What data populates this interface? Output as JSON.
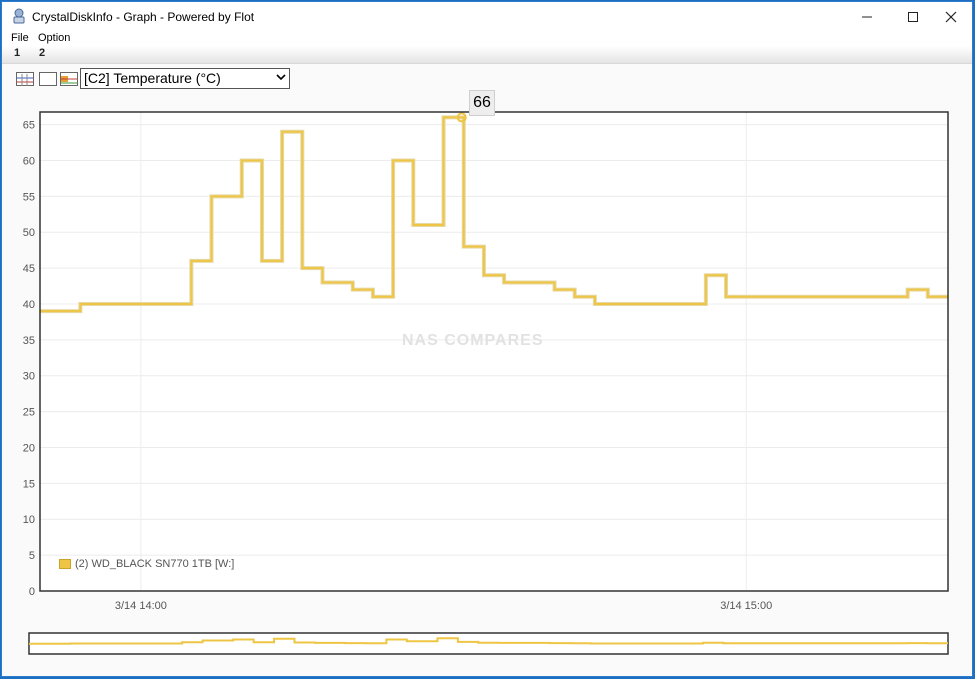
{
  "window": {
    "title": "CrystalDiskInfo - Graph - Powered by Flot",
    "minimize_icon": "minimize-icon",
    "maximize_icon": "maximize-icon",
    "close_icon": "close-icon"
  },
  "menu": {
    "items": [
      "File",
      "Option"
    ]
  },
  "tabs": [
    "1",
    "2"
  ],
  "toolbar": {
    "icons": [
      "graph-multi-icon",
      "graph-blank-icon",
      "graph-settings-icon"
    ],
    "attribute_select": "[C2] Temperature (°C)"
  },
  "tooltip": "66",
  "watermark": "NAS COMPARES",
  "legend": {
    "label": "(2) WD_BLACK SN770 1TB [W:]",
    "color": "#eec545"
  },
  "chart_data": {
    "type": "line",
    "series": [
      {
        "name": "(2) WD_BLACK SN770 1TB [W:]",
        "color": "#eec545",
        "step": true,
        "x": [
          "13:50",
          "13:54",
          "14:05",
          "14:07",
          "14:10",
          "14:12",
          "14:14",
          "14:16",
          "14:18",
          "14:21",
          "14:23",
          "14:25",
          "14:27",
          "14:30",
          "14:32",
          "14:34",
          "14:36",
          "14:39",
          "14:41",
          "14:43",
          "14:45",
          "14:48",
          "14:50",
          "14:56",
          "14:58",
          "15:06",
          "15:16",
          "15:18",
          "15:20"
        ],
        "values": [
          39,
          40,
          46,
          55,
          60,
          46,
          64,
          45,
          43,
          42,
          41,
          60,
          51,
          66,
          48,
          44,
          43,
          43,
          42,
          41,
          40,
          40,
          40,
          44,
          41,
          41,
          42,
          41,
          41
        ]
      }
    ],
    "yticks": [
      "0",
      "5",
      "10",
      "15",
      "20",
      "25",
      "30",
      "35",
      "40",
      "45",
      "50",
      "55",
      "60",
      "65"
    ],
    "xticks": [
      "3/14 14:00",
      "3/14 15:00"
    ],
    "ylim": [
      0,
      65
    ],
    "grid": true,
    "legend_position": "bottom-left"
  }
}
